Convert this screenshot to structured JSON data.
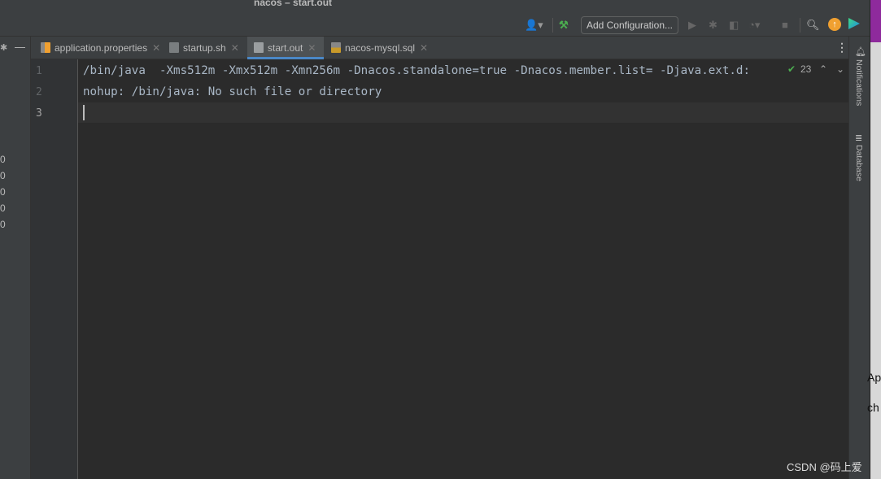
{
  "window": {
    "title": "nacos – start.out"
  },
  "toolbar": {
    "add_configuration": "Add Configuration..."
  },
  "tabs": [
    {
      "label": "application.properties",
      "icon": "properties-file-icon"
    },
    {
      "label": "startup.sh",
      "icon": "shell-script-icon"
    },
    {
      "label": "start.out",
      "icon": "text-file-icon",
      "active": true
    },
    {
      "label": "nacos-mysql.sql",
      "icon": "sql-file-icon"
    }
  ],
  "left_panel": {
    "numbers": [
      "0",
      "0",
      "0",
      "0",
      "0"
    ]
  },
  "editor": {
    "line_numbers": [
      "1",
      "2",
      "3"
    ],
    "lines": [
      "/bin/java  -Xms512m -Xmx512m -Xmn256m -Dnacos.standalone=true -Dnacos.member.list= -Djava.ext.d:",
      "nohup: /bin/java: No such file or directory",
      ""
    ],
    "inspection_count": "23"
  },
  "right_strip": {
    "notifications": "Notifications",
    "database": "Database"
  },
  "outside": {
    "text1": "Ap",
    "text2": "ch"
  },
  "watermark": "CSDN @码上爱",
  "colors": {
    "accent": "#4a88c7",
    "build": "#4caf50",
    "update": "#f0a030"
  }
}
